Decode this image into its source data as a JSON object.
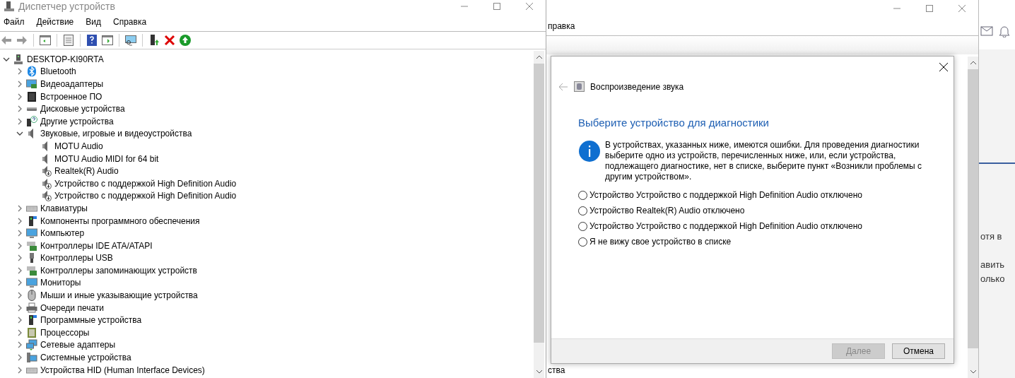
{
  "device_manager": {
    "title": "Диспетчер устройств",
    "menu": [
      "Файл",
      "Действие",
      "Вид",
      "Справка"
    ],
    "tree": {
      "label": "DESKTOP-KI90RTA",
      "expanded": true,
      "children": [
        {
          "label": "Bluetooth",
          "expanded": false
        },
        {
          "label": "Видеоадаптеры",
          "expanded": false
        },
        {
          "label": "Встроенное ПО",
          "expanded": false
        },
        {
          "label": "Дисковые устройства",
          "expanded": false
        },
        {
          "label": "Другие устройства",
          "expanded": false
        },
        {
          "label": "Звуковые, игровые и видеоустройства",
          "expanded": true,
          "children": [
            {
              "label": "MOTU Audio",
              "disabled": false
            },
            {
              "label": "MOTU Audio MIDI for 64 bit",
              "disabled": false
            },
            {
              "label": "Realtek(R) Audio",
              "disabled": true
            },
            {
              "label": "Устройство с поддержкой High Definition Audio",
              "disabled": true
            },
            {
              "label": "Устройство с поддержкой High Definition Audio",
              "disabled": true
            }
          ]
        },
        {
          "label": "Клавиатуры",
          "expanded": false
        },
        {
          "label": "Компоненты программного обеспечения",
          "expanded": false
        },
        {
          "label": "Компьютер",
          "expanded": false
        },
        {
          "label": "Контроллеры IDE ATA/ATAPI",
          "expanded": false
        },
        {
          "label": "Контроллеры USB",
          "expanded": false
        },
        {
          "label": "Контроллеры запоминающих устройств",
          "expanded": false
        },
        {
          "label": "Мониторы",
          "expanded": false
        },
        {
          "label": "Мыши и иные указывающие устройства",
          "expanded": false
        },
        {
          "label": "Очереди печати",
          "expanded": false
        },
        {
          "label": "Программные устройства",
          "expanded": false
        },
        {
          "label": "Процессоры",
          "expanded": false
        },
        {
          "label": "Сетевые адаптеры",
          "expanded": false
        },
        {
          "label": "Системные устройства",
          "expanded": false
        },
        {
          "label": "Устройства HID (Human Interface Devices)",
          "expanded": false
        }
      ]
    }
  },
  "middle_window": {
    "menu_fragment": "правка",
    "bottom_fragment": "ства"
  },
  "background_app": {
    "fragments": [
      "отя в",
      "авить",
      "олько"
    ]
  },
  "dialog": {
    "title": "Воспроизведение звука",
    "heading": "Выберите устройство для диагностики",
    "info": "В устройствах, указанных ниже, имеются ошибки. Для проведения диагностики выберите одно из устройств, перечисленных ниже, или, если устройства, подлежащего диагностике, нет в списке, выберите пункт «Возникли проблемы с другим устройством».",
    "options": [
      {
        "label": "Устройство Устройство с поддержкой High Definition Audio отключено",
        "selected": false
      },
      {
        "label": "Устройство Realtek(R) Audio отключено",
        "selected": false
      },
      {
        "label": "Устройство Устройство с поддержкой High Definition Audio отключено",
        "selected": false
      },
      {
        "label": "Я не вижу свое устройство в списке",
        "selected": false
      }
    ],
    "buttons": [
      {
        "label": "Далее",
        "disabled": true
      },
      {
        "label": "Отмена",
        "disabled": false
      }
    ]
  }
}
